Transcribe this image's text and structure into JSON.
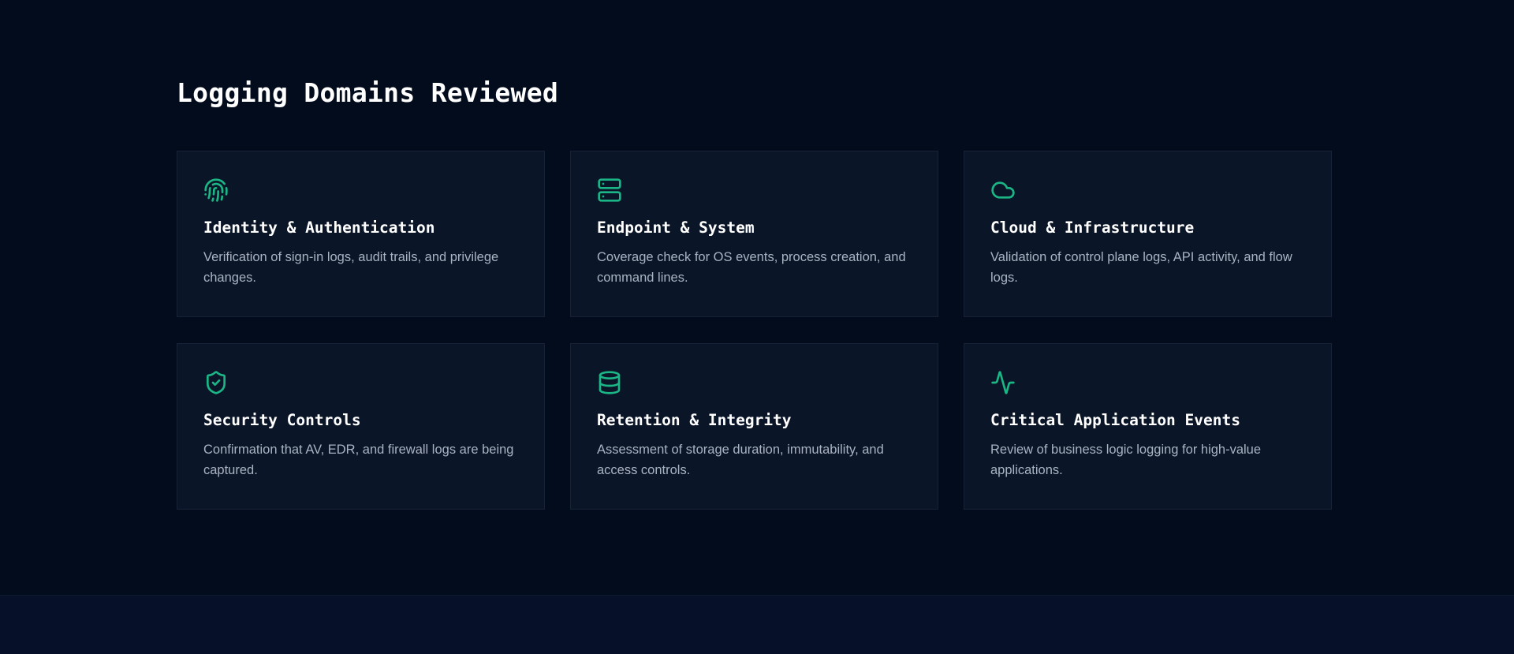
{
  "section": {
    "title": "Logging Domains Reviewed"
  },
  "colors": {
    "background": "#030c1c",
    "card_background": "#0a1527",
    "card_border": "#172236",
    "accent": "#1cb585",
    "title_text": "#ffffff",
    "body_text": "#a9b3c2",
    "footer_background": "#061129"
  },
  "cards": [
    {
      "icon": "fingerprint-icon",
      "title": "Identity & Authentication",
      "description": "Verification of sign-in logs, audit trails, and privilege changes."
    },
    {
      "icon": "server-icon",
      "title": "Endpoint & System",
      "description": "Coverage check for OS events, process creation, and command lines."
    },
    {
      "icon": "cloud-icon",
      "title": "Cloud & Infrastructure",
      "description": "Validation of control plane logs, API activity, and flow logs."
    },
    {
      "icon": "shield-check-icon",
      "title": "Security Controls",
      "description": "Confirmation that AV, EDR, and firewall logs are being captured."
    },
    {
      "icon": "database-icon",
      "title": "Retention & Integrity",
      "description": "Assessment of storage duration, immutability, and access controls."
    },
    {
      "icon": "activity-icon",
      "title": "Critical Application Events",
      "description": "Review of business logic logging for high-value applications."
    }
  ]
}
